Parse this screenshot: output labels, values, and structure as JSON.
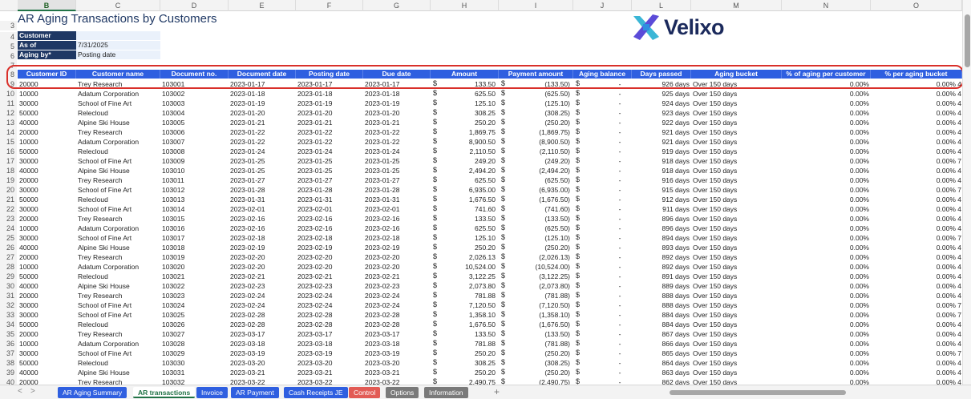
{
  "sheet": {
    "title": "AR Aging Transactions by Customers",
    "columns": [
      "B",
      "C",
      "D",
      "E",
      "F",
      "G",
      "H",
      "I",
      "J",
      "L",
      "M",
      "N",
      "O"
    ],
    "params": [
      {
        "label": "Customer",
        "value": ""
      },
      {
        "label": "As of",
        "value": "7/31/2025"
      },
      {
        "label": "Aging by*",
        "value": "Posting date"
      }
    ],
    "logo_text": "Velixo",
    "headers": [
      "Customer ID",
      "Customer name",
      "Document no.",
      "Document date",
      "Posting date",
      "Due date",
      "Amount",
      "Payment amount",
      "Aging balance",
      "Days passed",
      "Aging bucket",
      "% of aging per customer",
      "% per aging bucket"
    ],
    "rows": [
      [
        "20000",
        "Trey Research",
        "103001",
        "2023-01-17",
        "2023-01-17",
        "2023-01-17",
        "133.50",
        "(133.50)",
        "-",
        "926 days",
        "Over 150 days",
        "0.00%",
        "0.00% 4"
      ],
      [
        "10000",
        "Adatum Corporation",
        "103002",
        "2023-01-18",
        "2023-01-18",
        "2023-01-18",
        "625.50",
        "(625.50)",
        "-",
        "925 days",
        "Over 150 days",
        "0.00%",
        "0.00% 4"
      ],
      [
        "30000",
        "School of Fine Art",
        "103003",
        "2023-01-19",
        "2023-01-19",
        "2023-01-19",
        "125.10",
        "(125.10)",
        "-",
        "924 days",
        "Over 150 days",
        "0.00%",
        "0.00% 4"
      ],
      [
        "50000",
        "Relecloud",
        "103004",
        "2023-01-20",
        "2023-01-20",
        "2023-01-20",
        "308.25",
        "(308.25)",
        "-",
        "923 days",
        "Over 150 days",
        "0.00%",
        "0.00% 4"
      ],
      [
        "40000",
        "Alpine Ski House",
        "103005",
        "2023-01-21",
        "2023-01-21",
        "2023-01-21",
        "250.20",
        "(250.20)",
        "-",
        "922 days",
        "Over 150 days",
        "0.00%",
        "0.00% 4"
      ],
      [
        "20000",
        "Trey Research",
        "103006",
        "2023-01-22",
        "2023-01-22",
        "2023-01-22",
        "1,869.75",
        "(1,869.75)",
        "-",
        "921 days",
        "Over 150 days",
        "0.00%",
        "0.00% 4"
      ],
      [
        "10000",
        "Adatum Corporation",
        "103007",
        "2023-01-22",
        "2023-01-22",
        "2023-01-22",
        "8,900.50",
        "(8,900.50)",
        "-",
        "921 days",
        "Over 150 days",
        "0.00%",
        "0.00% 4"
      ],
      [
        "50000",
        "Relecloud",
        "103008",
        "2023-01-24",
        "2023-01-24",
        "2023-01-24",
        "2,110.50",
        "(2,110.50)",
        "-",
        "919 days",
        "Over 150 days",
        "0.00%",
        "0.00% 4"
      ],
      [
        "30000",
        "School of Fine Art",
        "103009",
        "2023-01-25",
        "2023-01-25",
        "2023-01-25",
        "249.20",
        "(249.20)",
        "-",
        "918 days",
        "Over 150 days",
        "0.00%",
        "0.00% 7"
      ],
      [
        "40000",
        "Alpine Ski House",
        "103010",
        "2023-01-25",
        "2023-01-25",
        "2023-01-25",
        "2,494.20",
        "(2,494.20)",
        "-",
        "918 days",
        "Over 150 days",
        "0.00%",
        "0.00% 4"
      ],
      [
        "20000",
        "Trey Research",
        "103011",
        "2023-01-27",
        "2023-01-27",
        "2023-01-27",
        "625.50",
        "(625.50)",
        "-",
        "916 days",
        "Over 150 days",
        "0.00%",
        "0.00% 4"
      ],
      [
        "30000",
        "School of Fine Art",
        "103012",
        "2023-01-28",
        "2023-01-28",
        "2023-01-28",
        "6,935.00",
        "(6,935.00)",
        "-",
        "915 days",
        "Over 150 days",
        "0.00%",
        "0.00% 7"
      ],
      [
        "50000",
        "Relecloud",
        "103013",
        "2023-01-31",
        "2023-01-31",
        "2023-01-31",
        "1,676.50",
        "(1,676.50)",
        "-",
        "912 days",
        "Over 150 days",
        "0.00%",
        "0.00% 4"
      ],
      [
        "30000",
        "School of Fine Art",
        "103014",
        "2023-02-01",
        "2023-02-01",
        "2023-02-01",
        "741.60",
        "(741.60)",
        "-",
        "911 days",
        "Over 150 days",
        "0.00%",
        "0.00% 4"
      ],
      [
        "20000",
        "Trey Research",
        "103015",
        "2023-02-16",
        "2023-02-16",
        "2023-02-16",
        "133.50",
        "(133.50)",
        "-",
        "896 days",
        "Over 150 days",
        "0.00%",
        "0.00% 4"
      ],
      [
        "10000",
        "Adatum Corporation",
        "103016",
        "2023-02-16",
        "2023-02-16",
        "2023-02-16",
        "625.50",
        "(625.50)",
        "-",
        "896 days",
        "Over 150 days",
        "0.00%",
        "0.00% 4"
      ],
      [
        "30000",
        "School of Fine Art",
        "103017",
        "2023-02-18",
        "2023-02-18",
        "2023-02-18",
        "125.10",
        "(125.10)",
        "-",
        "894 days",
        "Over 150 days",
        "0.00%",
        "0.00% 7"
      ],
      [
        "40000",
        "Alpine Ski House",
        "103018",
        "2023-02-19",
        "2023-02-19",
        "2023-02-19",
        "250.20",
        "(250.20)",
        "-",
        "893 days",
        "Over 150 days",
        "0.00%",
        "0.00% 4"
      ],
      [
        "20000",
        "Trey Research",
        "103019",
        "2023-02-20",
        "2023-02-20",
        "2023-02-20",
        "2,026.13",
        "(2,026.13)",
        "-",
        "892 days",
        "Over 150 days",
        "0.00%",
        "0.00% 4"
      ],
      [
        "10000",
        "Adatum Corporation",
        "103020",
        "2023-02-20",
        "2023-02-20",
        "2023-02-20",
        "10,524.00",
        "(10,524.00)",
        "-",
        "892 days",
        "Over 150 days",
        "0.00%",
        "0.00% 4"
      ],
      [
        "50000",
        "Relecloud",
        "103021",
        "2023-02-21",
        "2023-02-21",
        "2023-02-21",
        "3,122.25",
        "(3,122.25)",
        "-",
        "891 days",
        "Over 150 days",
        "0.00%",
        "0.00% 4"
      ],
      [
        "40000",
        "Alpine Ski House",
        "103022",
        "2023-02-23",
        "2023-02-23",
        "2023-02-23",
        "2,073.80",
        "(2,073.80)",
        "-",
        "889 days",
        "Over 150 days",
        "0.00%",
        "0.00% 4"
      ],
      [
        "20000",
        "Trey Research",
        "103023",
        "2023-02-24",
        "2023-02-24",
        "2023-02-24",
        "781.88",
        "(781.88)",
        "-",
        "888 days",
        "Over 150 days",
        "0.00%",
        "0.00% 4"
      ],
      [
        "30000",
        "School of Fine Art",
        "103024",
        "2023-02-24",
        "2023-02-24",
        "2023-02-24",
        "7,120.50",
        "(7,120.50)",
        "-",
        "888 days",
        "Over 150 days",
        "0.00%",
        "0.00% 7"
      ],
      [
        "30000",
        "School of Fine Art",
        "103025",
        "2023-02-28",
        "2023-02-28",
        "2023-02-28",
        "1,358.10",
        "(1,358.10)",
        "-",
        "884 days",
        "Over 150 days",
        "0.00%",
        "0.00% 7"
      ],
      [
        "50000",
        "Relecloud",
        "103026",
        "2023-02-28",
        "2023-02-28",
        "2023-02-28",
        "1,676.50",
        "(1,676.50)",
        "-",
        "884 days",
        "Over 150 days",
        "0.00%",
        "0.00% 4"
      ],
      [
        "20000",
        "Trey Research",
        "103027",
        "2023-03-17",
        "2023-03-17",
        "2023-03-17",
        "133.50",
        "(133.50)",
        "-",
        "867 days",
        "Over 150 days",
        "0.00%",
        "0.00% 4"
      ],
      [
        "10000",
        "Adatum Corporation",
        "103028",
        "2023-03-18",
        "2023-03-18",
        "2023-03-18",
        "781.88",
        "(781.88)",
        "-",
        "866 days",
        "Over 150 days",
        "0.00%",
        "0.00% 4"
      ],
      [
        "30000",
        "School of Fine Art",
        "103029",
        "2023-03-19",
        "2023-03-19",
        "2023-03-19",
        "250.20",
        "(250.20)",
        "-",
        "865 days",
        "Over 150 days",
        "0.00%",
        "0.00% 7"
      ],
      [
        "50000",
        "Relecloud",
        "103030",
        "2023-03-20",
        "2023-03-20",
        "2023-03-20",
        "308.25",
        "(308.25)",
        "-",
        "864 days",
        "Over 150 days",
        "0.00%",
        "0.00% 4"
      ],
      [
        "40000",
        "Alpine Ski House",
        "103031",
        "2023-03-21",
        "2023-03-21",
        "2023-03-21",
        "250.20",
        "(250.20)",
        "-",
        "863 days",
        "Over 150 days",
        "0.00%",
        "0.00% 4"
      ],
      [
        "20000",
        "Trey Research",
        "103032",
        "2023-03-22",
        "2023-03-22",
        "2023-03-22",
        "2,490.75",
        "(2,490.75)",
        "-",
        "862 days",
        "Over 150 days",
        "0.00%",
        "0.00% 4"
      ]
    ],
    "currency_symbol": "$"
  },
  "tabs": [
    {
      "label": "AR Aging Summary",
      "color": "#2f5fe0",
      "active": false
    },
    {
      "label": "AR transactions",
      "color": "#ffffff",
      "active": true
    },
    {
      "label": "Invoice",
      "color": "#2f5fe0",
      "active": false
    },
    {
      "label": "AR Payment",
      "color": "#2f5fe0",
      "active": false
    },
    {
      "label": "Cash Receipts JE",
      "color": "#2f5fe0",
      "active": false
    },
    {
      "label": "Control",
      "color": "#e25b55",
      "active": false
    },
    {
      "label": "Options",
      "color": "#7a7a7a",
      "active": false
    },
    {
      "label": "Information",
      "color": "#7a7a7a",
      "active": false
    }
  ],
  "nav": {
    "prev": "<",
    "next": ">",
    "add": "+"
  },
  "colors": {
    "header_blue": "#2f5fe0",
    "label_navy": "#1f3864",
    "highlight_red": "#d9302a"
  }
}
